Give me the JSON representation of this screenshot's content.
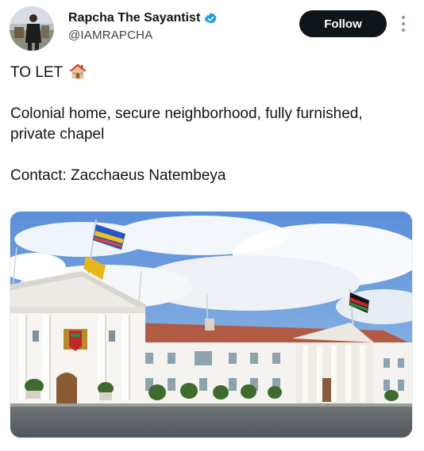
{
  "author": {
    "display_name": "Rapcha The Sayantist",
    "handle": "@IAMRAPCHA",
    "verified": true,
    "avatar_icon": "profile-photo"
  },
  "actions": {
    "follow_label": "Follow",
    "more_icon": "vertical-dots-icon"
  },
  "tweet": {
    "line1": "TO LET",
    "line1_emoji": "house-icon",
    "line2": "Colonial home, secure neighborhood, fully furnished,",
    "line3": "private chapel",
    "line4": "Contact: Zacchaeus Natembeya"
  },
  "media": {
    "type": "photo",
    "subject": "white colonial mansion with red tiled roof and flags"
  },
  "colors": {
    "text": "#0f1419",
    "secondary": "#3a3f45",
    "button_bg": "#0f1419",
    "verified_blue": "#1d9bf0"
  }
}
